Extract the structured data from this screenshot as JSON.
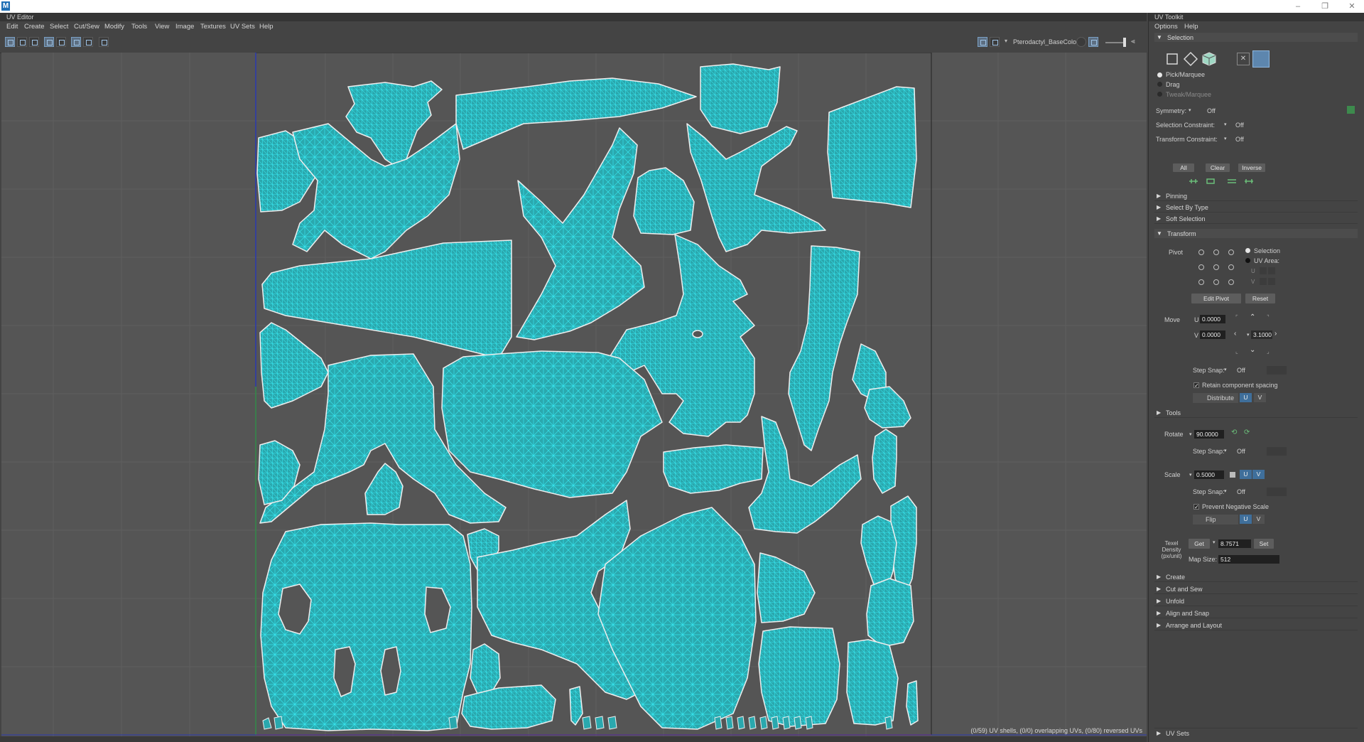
{
  "editor": {
    "title": "UV Editor",
    "menus": [
      "Edit",
      "Create",
      "Select",
      "Cut/Sew",
      "Modify",
      "Tools",
      "View",
      "Image",
      "Textures",
      "UV Sets",
      "Help"
    ],
    "texture_name": "Pterodactyl_BaseColor",
    "status": "(0/59) UV shells, (0/0) overlapping UVs, (0/80) reversed UVs"
  },
  "toolkit": {
    "title": "UV Toolkit",
    "menus": [
      "Options",
      "Help"
    ],
    "selection": {
      "header": "Selection",
      "modes": [
        "Pick/Marquee",
        "Drag",
        "Tweak/Marquee"
      ],
      "symmetry_label": "Symmetry:",
      "symmetry_value": "Off",
      "selection_constraint_label": "Selection Constraint:",
      "selection_constraint_value": "Off",
      "transform_constraint_label": "Transform Constraint:",
      "transform_constraint_value": "Off",
      "buttons": [
        "All",
        "Clear",
        "Inverse"
      ],
      "subsections": [
        "Pinning",
        "Select By Type",
        "Soft Selection"
      ]
    },
    "transform": {
      "header": "Transform",
      "pivot_label": "Pivot",
      "pivot_options": [
        "Selection",
        "UV Area:"
      ],
      "edit_pivot": "Edit Pivot",
      "reset": "Reset",
      "move_label": "Move",
      "u_label": "U",
      "v_label": "V",
      "move_u": "0.0000",
      "move_v": "0.0000",
      "move_step": "3.1000",
      "step_snap_label": "Step Snap:",
      "step_snap_value": "Off",
      "retain_spacing": "Retain component spacing",
      "distribute": "Distribute",
      "tools_label": "Tools",
      "rotate_label": "Rotate",
      "rotate_value": "90.0000",
      "scale_label": "Scale",
      "scale_value": "0.5000",
      "prevent_negative_scale": "Prevent Negative Scale",
      "flip": "Flip",
      "texel_density_label": "Texel Density (px/unit)",
      "get": "Get",
      "texel_value": "8.7571",
      "set": "Set",
      "map_size_label": "Map Size:",
      "map_size_value": "512"
    },
    "collapsed_sections": [
      "Create",
      "Cut and Sew",
      "Unfold",
      "Align and Snap",
      "Arrange and Layout"
    ],
    "uv_sets": "UV Sets"
  },
  "colors": {
    "uv_wire": "#1fb8bf",
    "uv_fill": "#2aa8ae",
    "shell_border": "#e8e8e8"
  }
}
